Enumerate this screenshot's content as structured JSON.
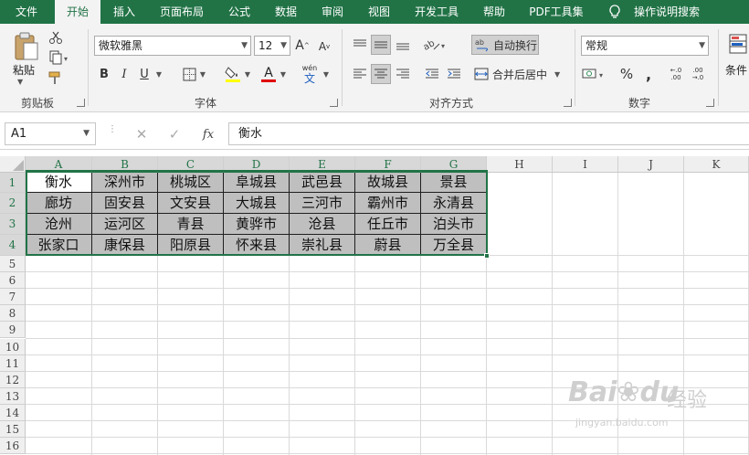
{
  "tabs": [
    "文件",
    "开始",
    "插入",
    "页面布局",
    "公式",
    "数据",
    "审阅",
    "视图",
    "开发工具",
    "帮助",
    "PDF工具集",
    "操作说明搜索"
  ],
  "ribbon": {
    "clipboard": {
      "paste": "粘贴",
      "label": "剪贴板"
    },
    "font": {
      "name": "微软雅黑",
      "size": "12",
      "bold": "B",
      "italic": "I",
      "underline": "U",
      "grow": "A",
      "shrink": "A",
      "fill": "A",
      "wen": "wén",
      "wen_sub": "文",
      "label": "字体"
    },
    "alignment": {
      "wrap": "自动换行",
      "merge": "合并后居中",
      "label": "对齐方式"
    },
    "number": {
      "format": "常规",
      "percent": "%",
      "comma": ",",
      "inc": "←.0\n.00",
      "dec": ".00\n→.0",
      "label": "数字"
    },
    "styles": {
      "cond": "条件"
    }
  },
  "formula_bar": {
    "namebox": "A1",
    "fx": "fx",
    "content": "衡水"
  },
  "grid": {
    "columns": [
      "A",
      "B",
      "C",
      "D",
      "E",
      "F",
      "G",
      "H",
      "I",
      "J",
      "K"
    ],
    "rows": [
      "1",
      "2",
      "3",
      "4",
      "5",
      "6",
      "7",
      "8",
      "9",
      "10",
      "11",
      "12",
      "13",
      "14",
      "15",
      "16"
    ],
    "cells": [
      [
        "衡水",
        "深州市",
        "桃城区",
        "阜城县",
        "武邑县",
        "故城县",
        "景县"
      ],
      [
        "廊坊",
        "固安县",
        "文安县",
        "大城县",
        "三河市",
        "霸州市",
        "永清县"
      ],
      [
        "沧州",
        "运河区",
        "青县",
        "黄骅市",
        "沧县",
        "任丘市",
        "泊头市"
      ],
      [
        "张家口",
        "康保县",
        "阳原县",
        "怀来县",
        "崇礼县",
        "蔚县",
        "万全县"
      ]
    ]
  },
  "watermark": {
    "brand": "Bai",
    "brand2": "du",
    "jingyan": "经验",
    "url": "jingyan.baidu.com"
  }
}
